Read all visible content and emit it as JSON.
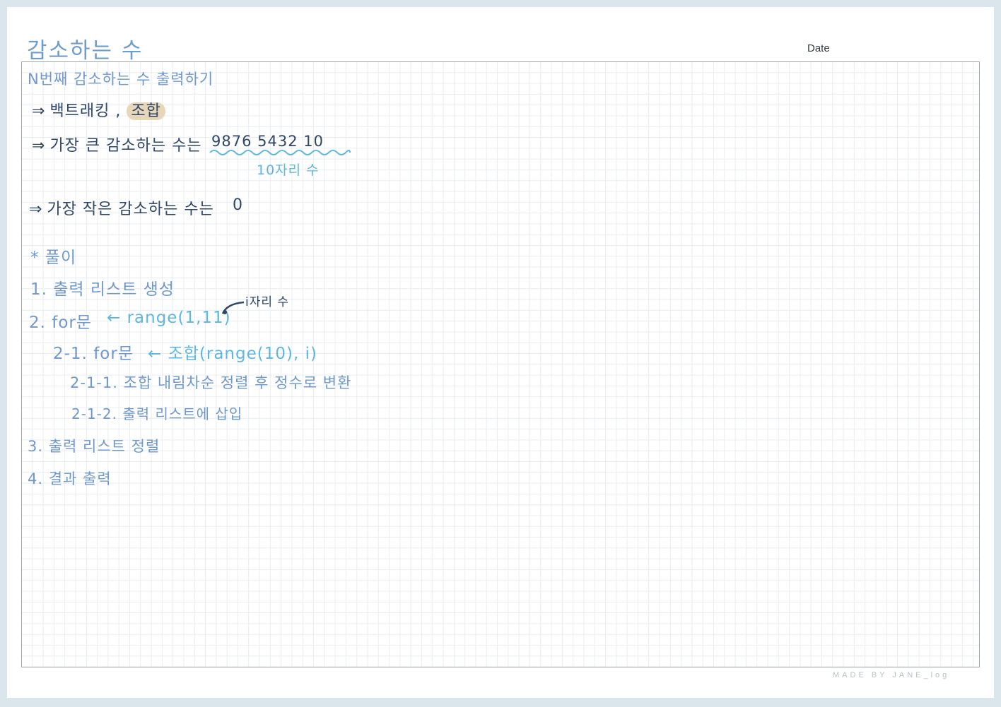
{
  "note": {
    "title": "감소하는 수",
    "date_label": "Date"
  },
  "lines": {
    "problem": "N번째 감소하는 수 출력하기",
    "approach_arrow": "⇒",
    "approach": "백트래킹 ,",
    "approach_highlight": "조합",
    "largest_arrow": "⇒",
    "largest_label": "가장 큰 감소하는 수는",
    "largest_value": "9876  5432  10",
    "largest_note": "10자리 수",
    "smallest_arrow": "⇒",
    "smallest_label": "가장 작은 감소하는 수는",
    "smallest_value": "0",
    "solution_heading": "* 풀이",
    "step1": "1. 출력 리스트 생성",
    "step2_label": "2. for문",
    "step2_code": "← range(1,11)",
    "step2_note": "i자리 수",
    "step2_1_label": "2-1. for문",
    "step2_1_code": "← 조합(range(10), i)",
    "step2_1_1": "2-1-1. 조합 내림차순 정렬 후 정수로 변환",
    "step2_1_2": "2-1-2. 출력 리스트에 삽입",
    "step3": "3. 출력 리스트 정렬",
    "step4": "4. 결과 출력"
  },
  "footer": {
    "brand": "MADE BY JANE_log"
  },
  "colors": {
    "page_background": "#dbe6ec",
    "title_blue": "#6f98cd",
    "ink_dark": "#2f4668",
    "code_sky": "#5fb7df",
    "highlight": "#e8d6b8"
  }
}
